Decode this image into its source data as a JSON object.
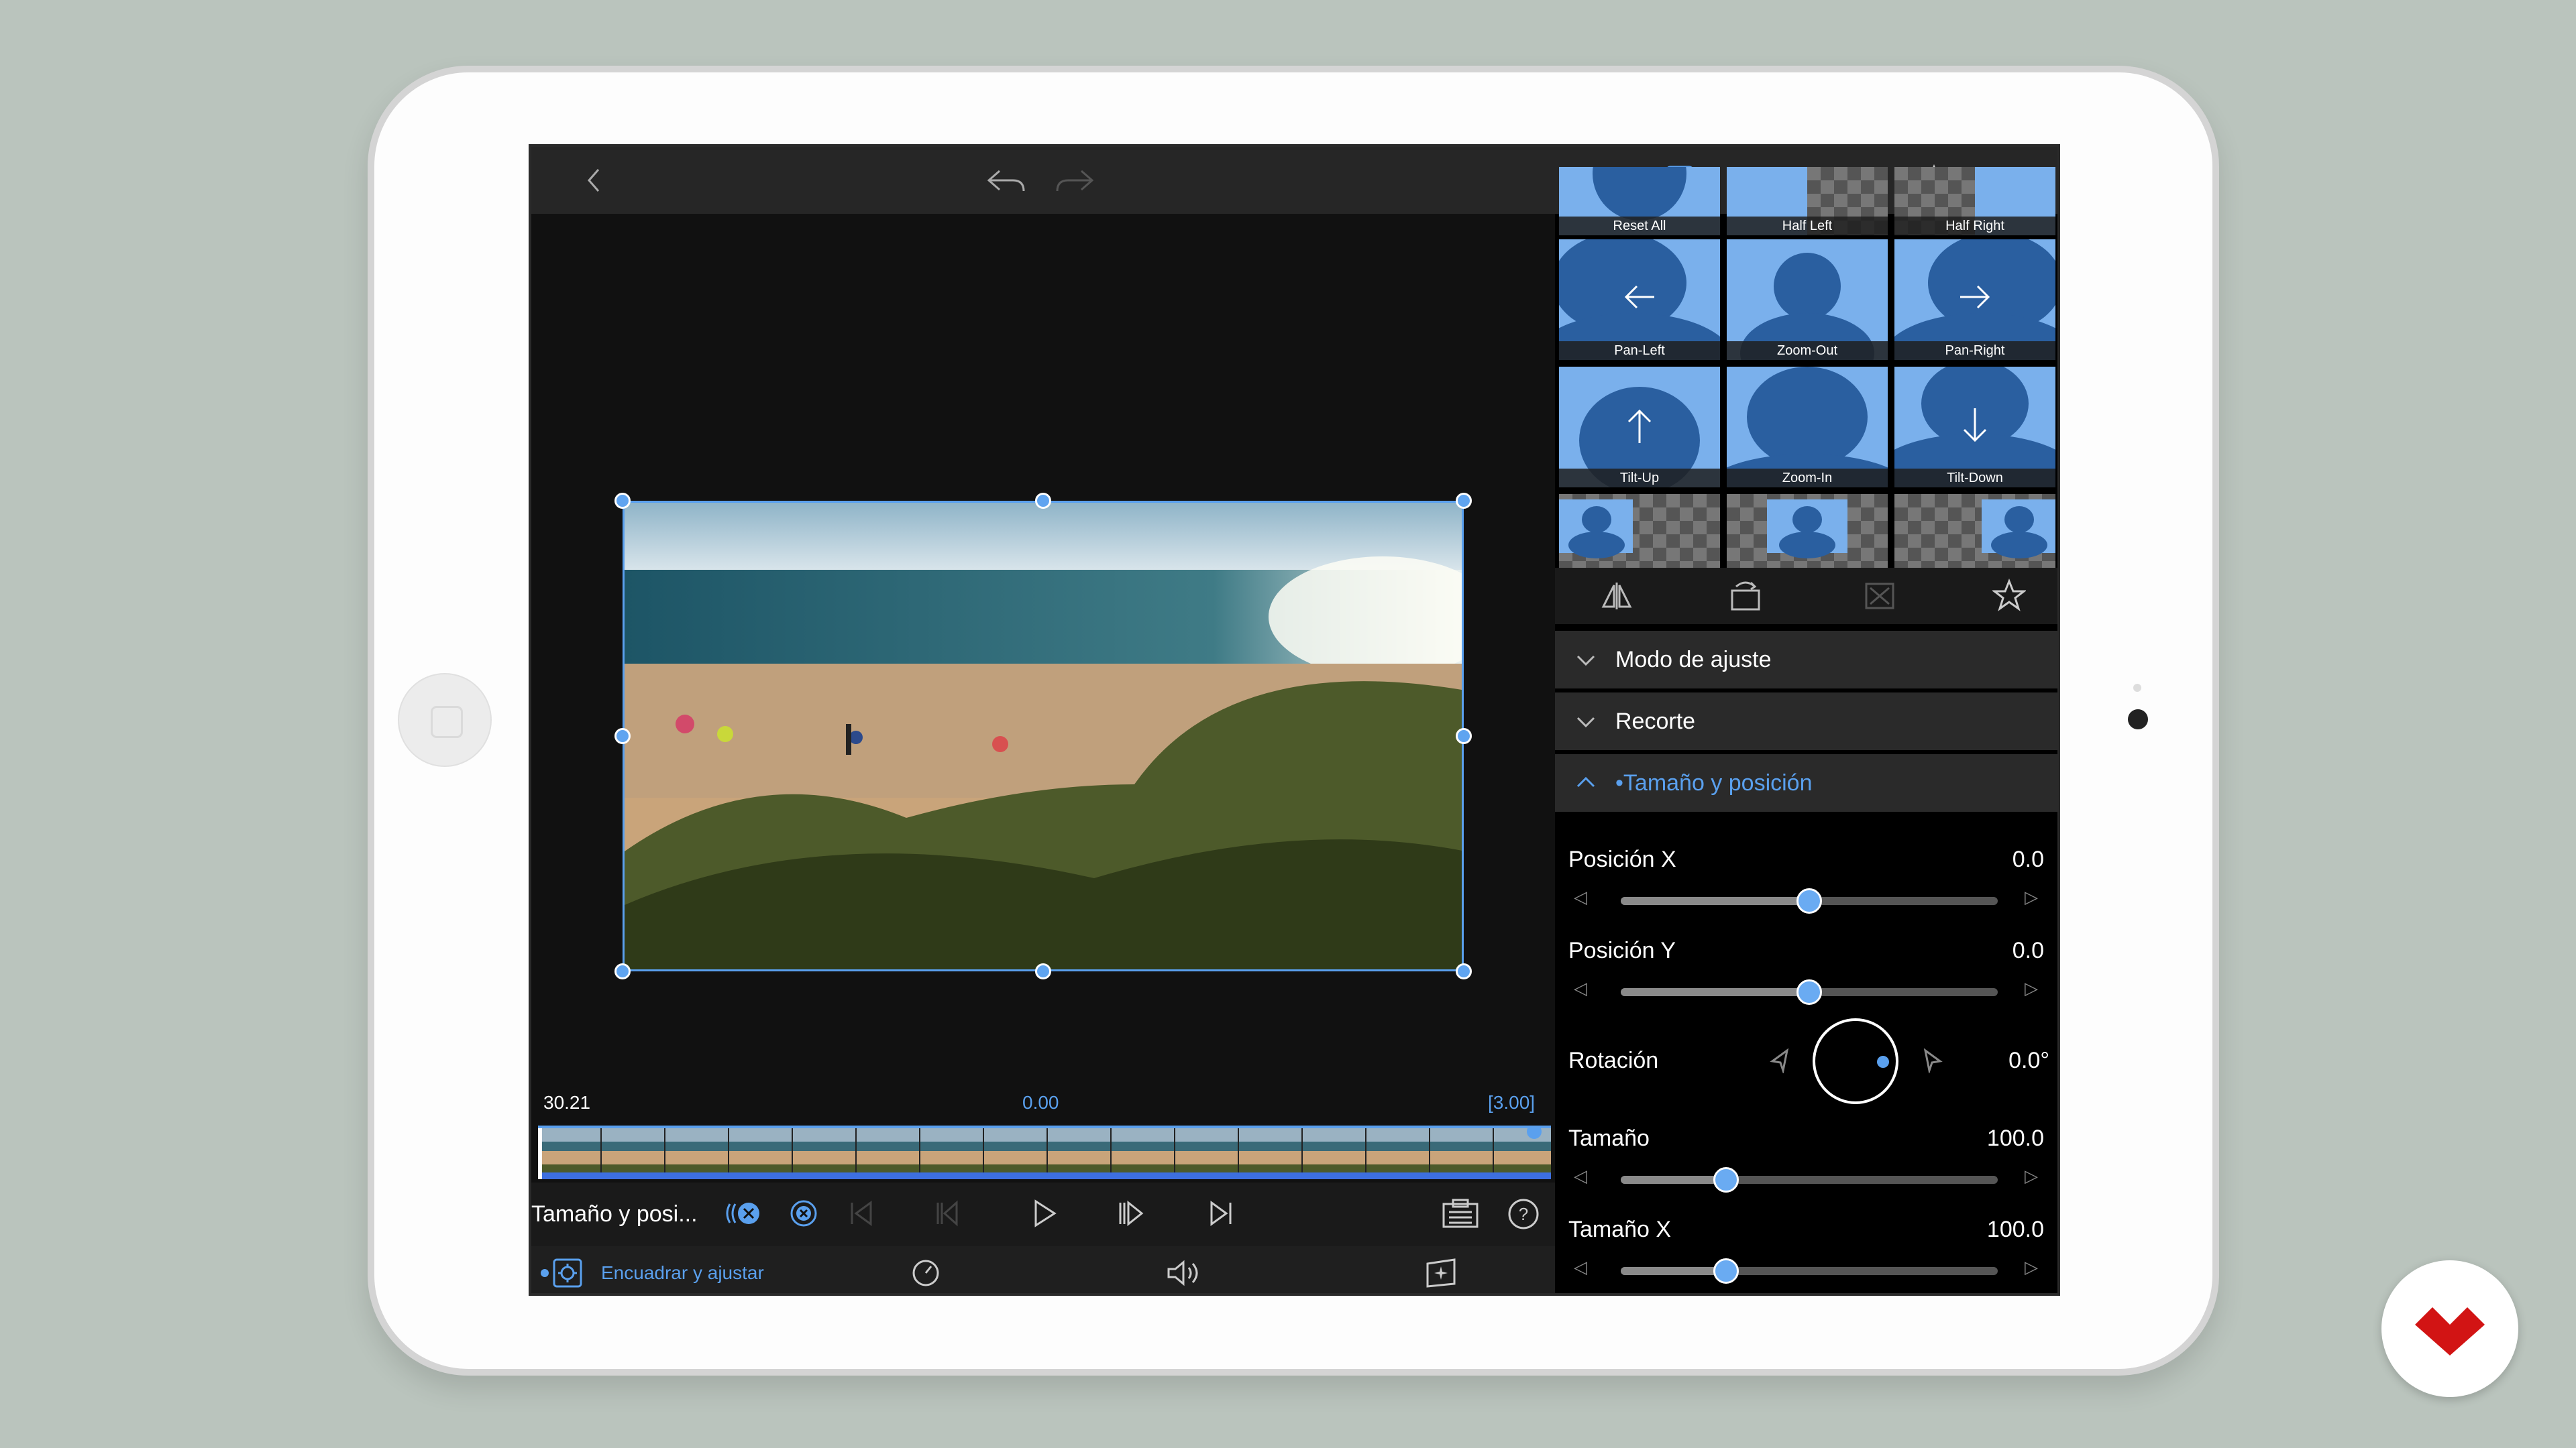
{
  "topbar": {
    "back_icon": "chevron-left-icon",
    "undo_icon": "undo-icon",
    "redo_icon": "redo-icon",
    "transform_icon": "transform-icon",
    "favorite_icon": "star-icon"
  },
  "timeline": {
    "start_time": "30.21",
    "current_time": "0.00",
    "duration": "[3.00]"
  },
  "playbar": {
    "clip_title": "Tamaño y posi...",
    "icons": [
      "keyframe-icon",
      "remove-keyframe-icon",
      "skip-start-icon",
      "previous-keyframe-icon",
      "play-icon",
      "next-keyframe-icon",
      "skip-end-icon",
      "clipboard-icon",
      "help-icon"
    ]
  },
  "bottombar": {
    "mode_label": "Encuadrar y ajustar",
    "icons": [
      "speed-icon",
      "volume-icon",
      "effects-icon"
    ]
  },
  "presets": [
    {
      "label": "Reset All"
    },
    {
      "label": "Half Left"
    },
    {
      "label": "Half Right"
    },
    {
      "label": "Pan-Left"
    },
    {
      "label": "Zoom-Out"
    },
    {
      "label": "Pan-Right"
    },
    {
      "label": "Tilt-Up"
    },
    {
      "label": "Zoom-In"
    },
    {
      "label": "Tilt-Down"
    }
  ],
  "preset_toolbar": [
    "flip-icon",
    "rotate-icon",
    "fit-icon",
    "star-icon"
  ],
  "sections": [
    {
      "label": "Modo de ajuste",
      "expanded": false
    },
    {
      "label": "Recorte",
      "expanded": false
    },
    {
      "label": "•Tamaño y posición",
      "expanded": true
    }
  ],
  "properties": {
    "pos_x": {
      "label": "Posición X",
      "value": "0.0",
      "fraction": 0.5
    },
    "pos_y": {
      "label": "Posición Y",
      "value": "0.0",
      "fraction": 0.5
    },
    "rotation": {
      "label": "Rotación",
      "value": "0.0°"
    },
    "size": {
      "label": "Tamaño",
      "value": "100.0",
      "fraction": 0.28
    },
    "size_x": {
      "label": "Tamaño X",
      "value": "100.0",
      "fraction": 0.28
    }
  },
  "colors": {
    "accent": "#5aa0ee",
    "logo": "#d21414"
  }
}
